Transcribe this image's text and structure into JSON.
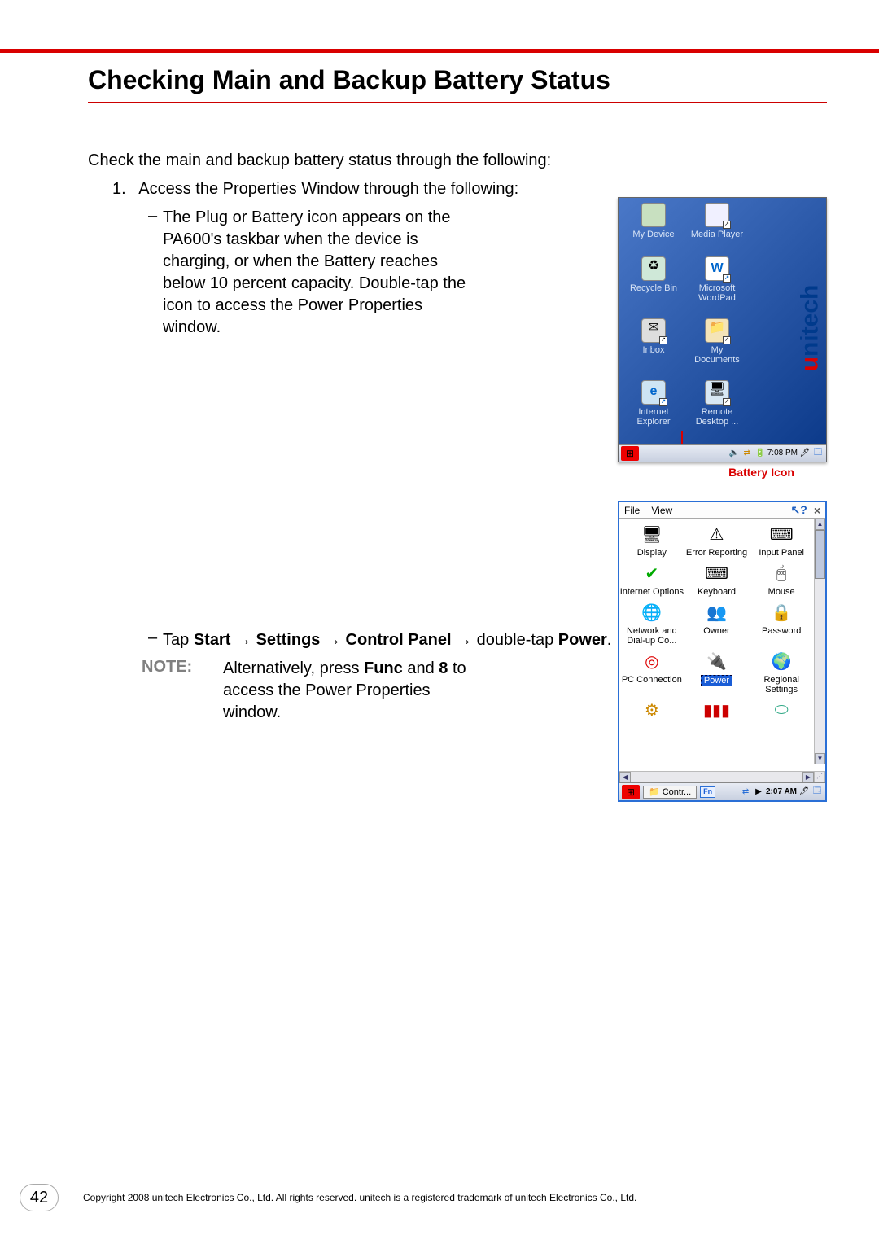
{
  "header": {
    "title": "Checking Main and Backup Battery Status"
  },
  "intro": "Check the main and backup battery status through the following:",
  "step1": {
    "prefix": "1.",
    "text": "Access the Properties Window through the following:"
  },
  "bullet1": "The Plug or Battery icon appears on the PA600's taskbar when the device is charging, or when the Battery reaches below 10 percent capacity. Double-tap the icon to access the Power Properties window.",
  "bullet2": {
    "p1": "Tap ",
    "b1": "Start",
    "a1": " → ",
    "b2": "Settings",
    "a2": " → ",
    "b3": "Control Panel",
    "a3": " → double-tap ",
    "b4": "Power",
    "a4": "."
  },
  "note": {
    "label": "NOTE:",
    "p1": "Alternatively, press ",
    "b1": "Func",
    "p2": " and ",
    "b2": "8",
    "p3": " to access the Power Properties window."
  },
  "fig1": {
    "icons": [
      {
        "name": "My Device"
      },
      {
        "name": "Media Player"
      },
      {
        "name": "Recycle Bin"
      },
      {
        "name": "Microsoft WordPad"
      },
      {
        "name": "Inbox"
      },
      {
        "name": "My Documents"
      },
      {
        "name": "Internet Explorer"
      },
      {
        "name": "Remote Desktop ..."
      }
    ],
    "taskbar_time": "7:08 PM",
    "brand": "unitech",
    "battery_label": "Battery Icon"
  },
  "fig2": {
    "menu": {
      "file": "File",
      "view": "View"
    },
    "items": [
      {
        "n": "Display"
      },
      {
        "n": "Error Reporting"
      },
      {
        "n": "Input Panel"
      },
      {
        "n": "Internet Options"
      },
      {
        "n": "Keyboard"
      },
      {
        "n": "Mouse"
      },
      {
        "n": "Network and Dial-up Co..."
      },
      {
        "n": "Owner"
      },
      {
        "n": "Password"
      },
      {
        "n": "PC Connection"
      },
      {
        "n": "Power",
        "sel": true
      },
      {
        "n": "Regional Settings"
      }
    ],
    "task_label": "Contr...",
    "fn": "Fn",
    "time": "2:07 AM"
  },
  "footer": {
    "page": "42",
    "copyright": "Copyright 2008 unitech Electronics Co., Ltd. All rights reserved. unitech is a registered trademark of unitech Electronics Co., Ltd."
  }
}
